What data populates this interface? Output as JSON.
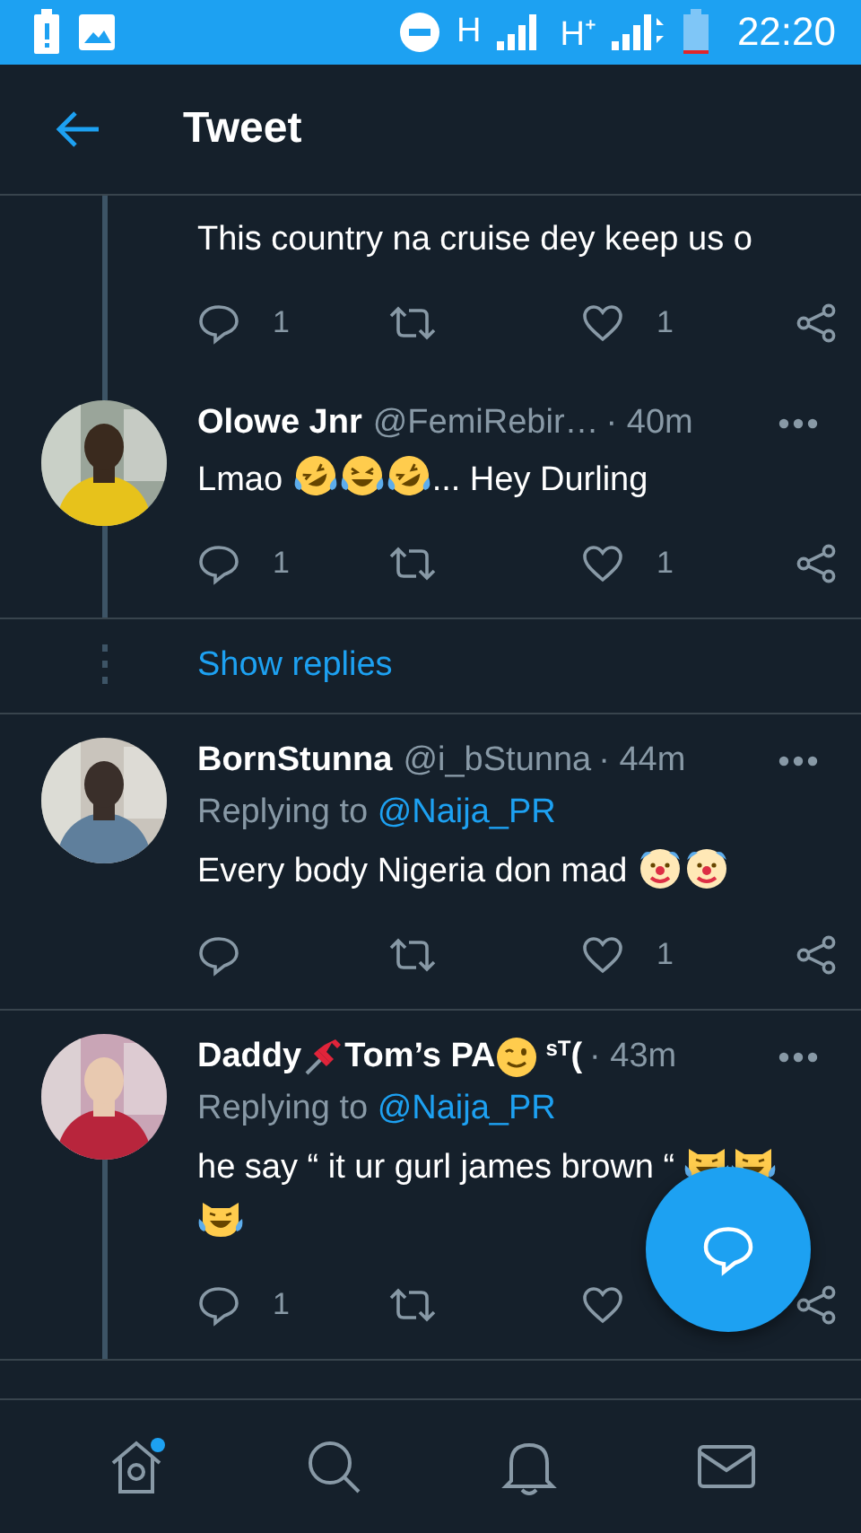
{
  "status_bar": {
    "time": "22:20",
    "network_1": "H",
    "network_2": "H⁺"
  },
  "header": {
    "title": "Tweet"
  },
  "items": [
    {
      "kind": "tweet",
      "thread_top": true,
      "thread_bottom": true,
      "body": [
        {
          "kind": "text",
          "text": "This country na cruise dey keep us o"
        }
      ],
      "reply_count": "1",
      "like_count": "1"
    },
    {
      "kind": "tweet",
      "thread_top": true,
      "thread_bottom": true,
      "name": [
        {
          "kind": "text",
          "text": "Olowe Jnr"
        }
      ],
      "handle": "@FemiRebir…",
      "time": "· 40m",
      "body": [
        {
          "kind": "text",
          "text": "Lmao "
        },
        {
          "kind": "rofl"
        },
        {
          "kind": "joy"
        },
        {
          "kind": "rofl"
        },
        {
          "kind": "text",
          "text": "... Hey Durling"
        }
      ],
      "reply_count": "1",
      "like_count": "1"
    },
    {
      "kind": "show-replies",
      "label": "Show replies"
    },
    {
      "kind": "tweet",
      "thread_top": false,
      "thread_bottom": false,
      "name": [
        {
          "kind": "text",
          "text": "BornStunna"
        }
      ],
      "handle": "@i_bStunna",
      "time": "· 44m",
      "replying": {
        "prefix": "Replying to ",
        "handle": "@Naija_PR"
      },
      "body": [
        {
          "kind": "text",
          "text": "Every body Nigeria don mad "
        },
        {
          "kind": "clown"
        },
        {
          "kind": "clown"
        }
      ],
      "like_count": "1"
    },
    {
      "kind": "tweet",
      "thread_top": false,
      "thread_bottom": true,
      "name": [
        {
          "kind": "text",
          "text": "Daddy"
        },
        {
          "kind": "pin"
        },
        {
          "kind": "text",
          "text": "Tom’s PA"
        },
        {
          "kind": "wink"
        },
        {
          "kind": "sup",
          "text": "sT"
        },
        {
          "kind": "text",
          "text": " ("
        }
      ],
      "time": "· 43m",
      "replying": {
        "prefix": "Replying to ",
        "handle": "@Naija_PR"
      },
      "body": [
        {
          "kind": "text",
          "text": "he say “ it ur gurl james brown “ "
        },
        {
          "kind": "catjoy"
        },
        {
          "kind": "catjoy"
        },
        {
          "kind": "catjoy"
        }
      ],
      "reply_count": "1"
    }
  ],
  "bottom_nav": [
    {
      "kind": "home",
      "badge": true
    },
    {
      "kind": "search",
      "badge": false
    },
    {
      "kind": "bell",
      "badge": false
    },
    {
      "kind": "mail",
      "badge": false
    }
  ]
}
